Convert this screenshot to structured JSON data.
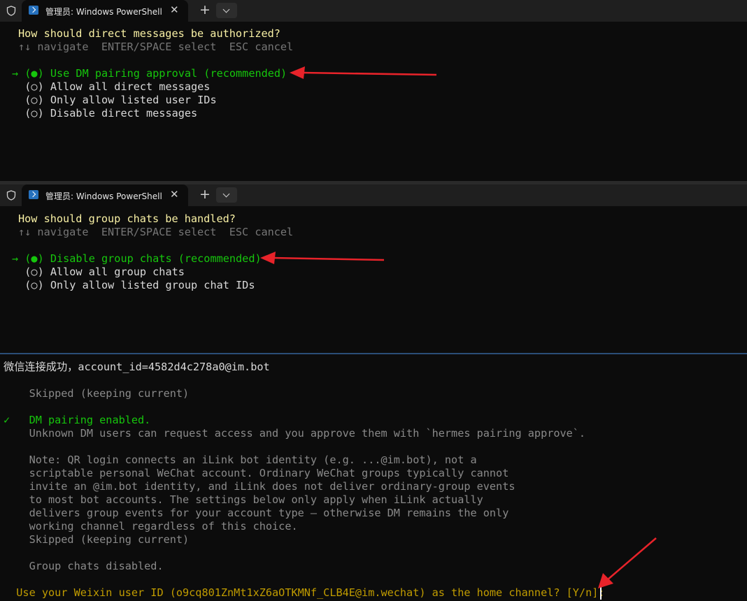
{
  "tabbar": {
    "title": "管理员: Windows PowerShell",
    "close": "✕",
    "new_tab": "+"
  },
  "pane1": {
    "question": "How should direct messages be authorized?",
    "hint": "↑↓ navigate  ENTER/SPACE select  ESC cancel",
    "options": [
      "→ (●) Use DM pairing approval (recommended)",
      "  (○) Allow all direct messages",
      "  (○) Only allow listed user IDs",
      "  (○) Disable direct messages"
    ]
  },
  "pane2": {
    "question": "How should group chats be handled?",
    "hint": "↑↓ navigate  ENTER/SPACE select  ESC cancel",
    "options": [
      "→ (●) Disable group chats (recommended)",
      "  (○) Allow all group chats",
      "  (○) Only allow listed group chat IDs"
    ]
  },
  "pane3": {
    "line1": "微信连接成功，account_id=4582d4c278a0@im.bot",
    "skipped1": "    Skipped (keeping current)",
    "check": "✓",
    "enabled": "    DM pairing enabled.",
    "unknown": "    Unknown DM users can request access and you approve them with `hermes pairing approve`.",
    "note": [
      "    Note: QR login connects an iLink bot identity (e.g. ...@im.bot), not a",
      "    scriptable personal WeChat account. Ordinary WeChat groups typically cannot",
      "    invite an @im.bot identity, and iLink does not deliver ordinary-group events",
      "    to most bot accounts. The settings below only apply when iLink actually",
      "    delivers group events for your account type — otherwise DM remains the only",
      "    working channel regardless of this choice.",
      "    Skipped (keeping current)"
    ],
    "group_disabled": "    Group chats disabled.",
    "prompt": "  Use your Weixin user ID (o9cq801ZnMt1xZ6aOTKMNf_CLB4E@im.wechat) as the home channel? [Y/n]: "
  },
  "colors": {
    "annotation_arrow": "#e8232a",
    "selected": "#16c60c",
    "question": "#f9f1a5",
    "prompt": "#c19c00"
  }
}
